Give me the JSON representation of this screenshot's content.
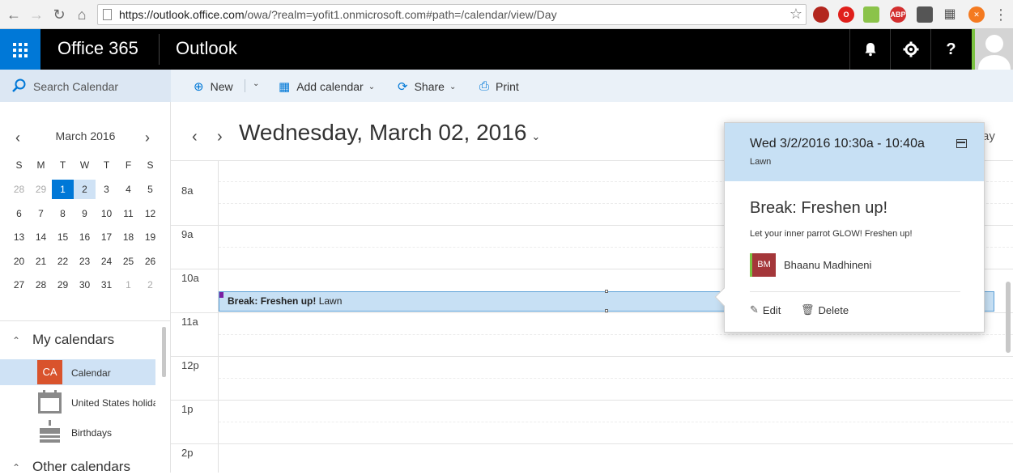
{
  "browser": {
    "url_host": "https://outlook.office.com",
    "url_path": "/owa/?realm=yofit1.onmicrosoft.com#path=/calendar/view/Day",
    "extensions": [
      "red-car-ext",
      "opera-ext",
      "hat-ext",
      "ABP",
      "puzzle-ext",
      "grid-ext",
      "orange-ext"
    ],
    "abp_label": "ABP"
  },
  "header": {
    "brand": "Office 365",
    "app": "Outlook",
    "icons": [
      "bell-icon",
      "gear-icon",
      "help-icon"
    ],
    "help_label": "?"
  },
  "search": {
    "placeholder": "Search Calendar"
  },
  "commands": {
    "new_label": "New",
    "add_calendar_label": "Add calendar",
    "share_label": "Share",
    "print_label": "Print"
  },
  "mini_calendar": {
    "month_label": "March 2016",
    "weekdays": [
      "S",
      "M",
      "T",
      "W",
      "T",
      "F",
      "S"
    ],
    "weeks": [
      [
        "28",
        "29",
        "1",
        "2",
        "3",
        "4",
        "5"
      ],
      [
        "6",
        "7",
        "8",
        "9",
        "10",
        "11",
        "12"
      ],
      [
        "13",
        "14",
        "15",
        "16",
        "17",
        "18",
        "19"
      ],
      [
        "20",
        "21",
        "22",
        "23",
        "24",
        "25",
        "26"
      ],
      [
        "27",
        "28",
        "29",
        "30",
        "31",
        "1",
        "2"
      ]
    ]
  },
  "nav": {
    "my_calendars_label": "My calendars",
    "other_calendars_label": "Other calendars",
    "calendars": [
      {
        "badge": "CA",
        "label": "Calendar",
        "color": "#d9532c"
      },
      {
        "badge": "",
        "label": "United States holidays",
        "color": "#8a8a8a"
      },
      {
        "badge": "",
        "label": "Birthdays",
        "color": "#8a8a8a"
      }
    ]
  },
  "day_view": {
    "title": "Wednesday, March 02, 2016",
    "view_label_partial": "ay",
    "hours": [
      "8a",
      "9a",
      "10a",
      "11a",
      "12p",
      "1p",
      "2p"
    ],
    "event": {
      "title": "Break: Freshen up!",
      "location": "Lawn",
      "color": "#c7e0f4"
    }
  },
  "peek": {
    "time": "Wed 3/2/2016 10:30a - 10:40a",
    "location": "Lawn",
    "title": "Break: Freshen up!",
    "description": "Let your inner parrot GLOW! Freshen up!",
    "attendee_initials": "BM",
    "attendee_name": "Bhaanu Madhineni",
    "edit_label": "Edit",
    "delete_label": "Delete"
  },
  "colors": {
    "accent": "#0078d7",
    "header_bg": "#000000",
    "event_bg": "#c7e0f4",
    "selected_bg": "#cfe2f5"
  }
}
